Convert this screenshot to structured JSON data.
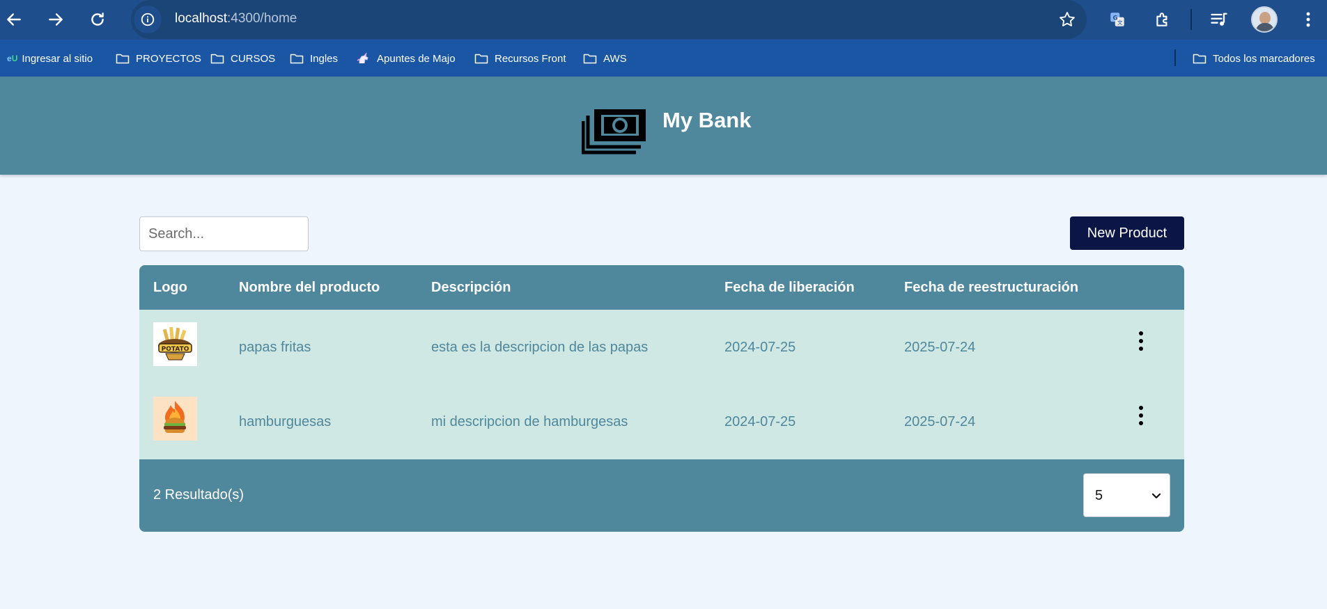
{
  "browser": {
    "url_host": "localhost",
    "url_path": ":4300/home",
    "bookmarks": [
      {
        "label": "Ingresar al sitio",
        "icon": "eu-site-icon"
      },
      {
        "label": "PROYECTOS",
        "icon": "folder-icon"
      },
      {
        "label": "CURSOS",
        "icon": "folder-icon"
      },
      {
        "label": "Ingles",
        "icon": "folder-icon"
      },
      {
        "label": "Apuntes de Majo",
        "icon": "unicorn-icon"
      },
      {
        "label": "Recursos Front",
        "icon": "folder-icon"
      },
      {
        "label": "AWS",
        "icon": "folder-icon"
      }
    ],
    "all_bookmarks_label": "Todos los marcadores"
  },
  "header": {
    "title": "My Bank",
    "logo_icon": "money-stack-icon"
  },
  "toolbar": {
    "search_placeholder": "Search...",
    "new_button_label": "New Product"
  },
  "table": {
    "columns": [
      "Logo",
      "Nombre del producto",
      "Descripción",
      "Fecha de liberación",
      "Fecha de reestructuración"
    ],
    "rows": [
      {
        "logo_icon": "potato-logo",
        "name": "papas fritas",
        "description": "esta es la descripcion de las papas",
        "release_date": "2024-07-25",
        "restructure_date": "2025-07-24"
      },
      {
        "logo_icon": "burger-logo",
        "name": "hamburguesas",
        "description": "mi descripcion de hamburgesas",
        "release_date": "2024-07-25",
        "restructure_date": "2025-07-24"
      }
    ],
    "result_count": "2 Resultado(s)",
    "page_size": "5"
  },
  "colors": {
    "chrome_top": "#1e4f8c",
    "bookmarks_bar": "#1a56a3",
    "header_bg": "#4f879c",
    "row_bg": "#cfe8e3",
    "page_bg": "#eef5fd",
    "button_bg": "#0c1646"
  }
}
